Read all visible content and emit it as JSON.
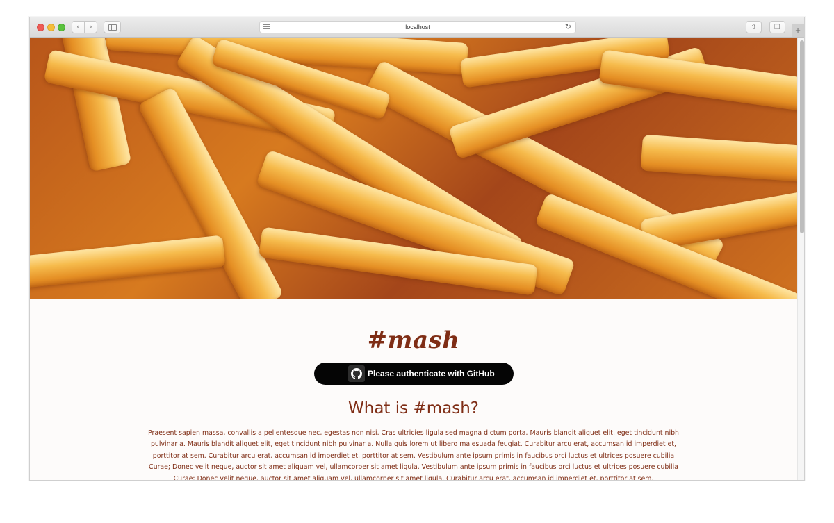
{
  "browser": {
    "address": "localhost"
  },
  "page": {
    "hero_image": "french-fries-photo",
    "brand": "#mash",
    "auth_button_label": "Please authenticate with GitHub",
    "heading": "What is #mash?",
    "paragraph": "Praesent sapien massa, convallis a pellentesque nec, egestas non nisi. Cras ultricies ligula sed magna dictum porta. Mauris blandit aliquet elit, eget tincidunt nibh pulvinar a. Mauris blandit aliquet elit, eget tincidunt nibh pulvinar a. Nulla quis lorem ut libero malesuada feugiat. Curabitur arcu erat, accumsan id imperdiet et, porttitor at sem. Curabitur arcu erat, accumsan id imperdiet et, porttitor at sem. Vestibulum ante ipsum primis in faucibus orci luctus et ultrices posuere cubilia Curae; Donec velit neque, auctor sit amet aliquam vel, ullamcorper sit amet ligula. Vestibulum ante ipsum primis in faucibus orci luctus et ultrices posuere cubilia Curae; Donec velit neque, auctor sit amet aliquam vel, ullamcorper sit amet ligula. Curabitur arcu erat, accumsan id imperdiet et, porttitor at sem."
  },
  "colors": {
    "brand": "#7f2d15",
    "button_bg": "#050505",
    "page_bg": "#fdfbfa"
  },
  "icons": {
    "github": "github-octocat-icon"
  }
}
